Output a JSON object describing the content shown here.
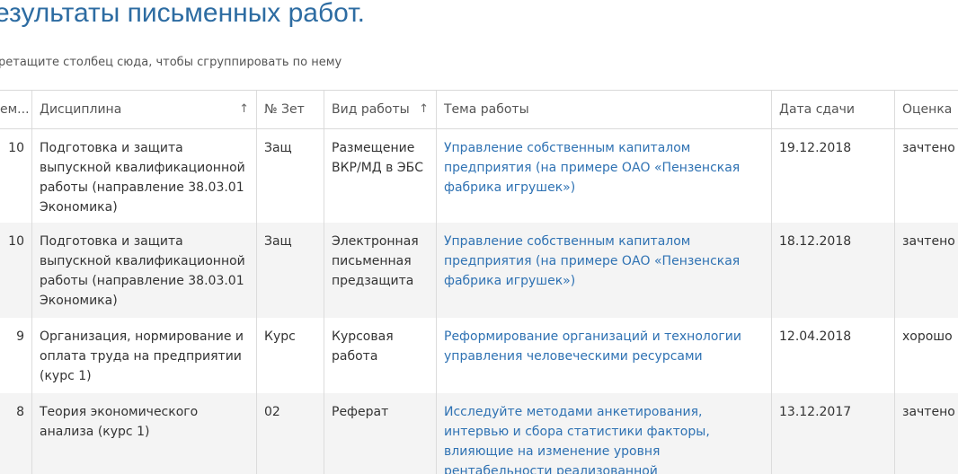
{
  "page": {
    "title": "езультаты письменных работ.",
    "group_hint": "ретащите столбец сюда, чтобы сгруппировать по нему"
  },
  "table": {
    "headers": {
      "semester": "ем...",
      "discipline": "Дисциплина",
      "zet": "№ Зет",
      "work_type": "Вид работы",
      "topic": "Тема работы",
      "date": "Дата сдачи",
      "grade": "Оценка"
    },
    "sort_indicator": "↑",
    "rows": [
      {
        "semester": "10",
        "discipline": "Подготовка и защита выпускной квалификационной работы (направление 38.03.01 Экономика)",
        "zet": "Защ",
        "work_type": "Размещение ВКР/МД в ЭБС",
        "topic": "Управление собственным капиталом предприятия (на примере ОАО «Пензенская фабрика игрушек»)",
        "date": "19.12.2018",
        "grade": "зачтено"
      },
      {
        "semester": "10",
        "discipline": "Подготовка и защита выпускной квалификационной работы (направление 38.03.01 Экономика)",
        "zet": "Защ",
        "work_type": "Электронная письменная предзащита",
        "topic": "Управление собственным капиталом предприятия (на примере ОАО «Пензенская фабрика игрушек»)",
        "date": "18.12.2018",
        "grade": "зачтено"
      },
      {
        "semester": "9",
        "discipline": "Организация, нормирование и оплата труда на предприятии (курс 1)",
        "zet": "Курс",
        "work_type": "Курсовая работа",
        "topic": "Реформирование организаций и технологии управления человеческими ресурсами",
        "date": "12.04.2018",
        "grade": "хорошо"
      },
      {
        "semester": "8",
        "discipline": "Теория экономического анализа (курс 1)",
        "zet": "02",
        "work_type": "Реферат",
        "topic": "Исследуйте методами анкетирования, интервью и сбора статистики факторы, влияющие на изменение уровня рентабельности реализованной",
        "date": "13.12.2017",
        "grade": "зачтено"
      }
    ]
  }
}
